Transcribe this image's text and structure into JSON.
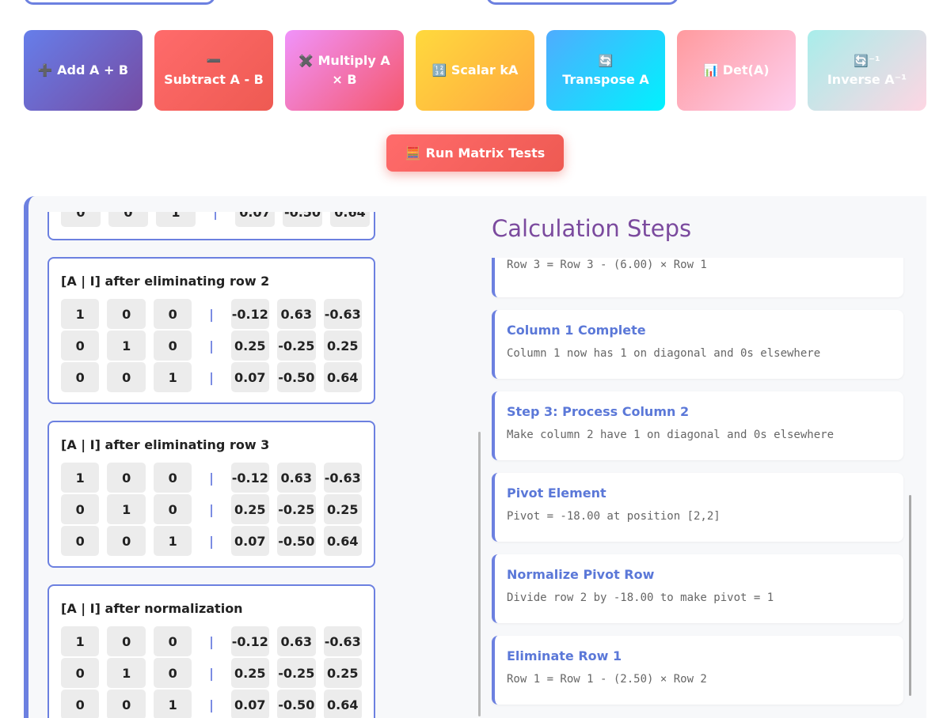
{
  "operations": [
    {
      "icon": "➕",
      "label": "Add A + B"
    },
    {
      "icon": "➖",
      "label": "Subtract A - B"
    },
    {
      "icon": "✖️",
      "label": "Multiply A × B"
    },
    {
      "icon": "🔢",
      "label": "Scalar kA"
    },
    {
      "icon": "🔄",
      "label": "Transpose A"
    },
    {
      "icon": "📊",
      "label": "Det(A)"
    },
    {
      "icon": "🔄⁻¹",
      "label": "Inverse A⁻¹"
    }
  ],
  "run_button": {
    "icon": "🧮",
    "label": "Run Matrix Tests"
  },
  "matrix_cards": {
    "partial": {
      "row": [
        "0",
        "0",
        "1",
        "0.07",
        "-0.50",
        "0.64"
      ]
    },
    "cards": [
      {
        "title": "[A | I] after eliminating row 2",
        "rows": [
          {
            "left": [
              "1",
              "0",
              "0"
            ],
            "sep": "|",
            "right": [
              "-0.12",
              "0.63",
              "-0.63"
            ]
          },
          {
            "left": [
              "0",
              "1",
              "0"
            ],
            "sep": "|",
            "right": [
              "0.25",
              "-0.25",
              "0.25"
            ]
          },
          {
            "left": [
              "0",
              "0",
              "1"
            ],
            "sep": "|",
            "right": [
              "0.07",
              "-0.50",
              "0.64"
            ]
          }
        ]
      },
      {
        "title": "[A | I] after eliminating row 3",
        "rows": [
          {
            "left": [
              "1",
              "0",
              "0"
            ],
            "sep": "|",
            "right": [
              "-0.12",
              "0.63",
              "-0.63"
            ]
          },
          {
            "left": [
              "0",
              "1",
              "0"
            ],
            "sep": "|",
            "right": [
              "0.25",
              "-0.25",
              "0.25"
            ]
          },
          {
            "left": [
              "0",
              "0",
              "1"
            ],
            "sep": "|",
            "right": [
              "0.07",
              "-0.50",
              "0.64"
            ]
          }
        ]
      },
      {
        "title": "[A | I] after normalization",
        "rows": [
          {
            "left": [
              "1",
              "0",
              "0"
            ],
            "sep": "|",
            "right": [
              "-0.12",
              "0.63",
              "-0.63"
            ]
          },
          {
            "left": [
              "0",
              "1",
              "0"
            ],
            "sep": "|",
            "right": [
              "0.25",
              "-0.25",
              "0.25"
            ]
          },
          {
            "left": [
              "0",
              "0",
              "1"
            ],
            "sep": "|",
            "right": [
              "0.07",
              "-0.50",
              "0.64"
            ]
          }
        ]
      }
    ]
  },
  "steps": {
    "title": "Calculation Steps",
    "items": [
      {
        "title": "",
        "desc": "Row 3 = Row 3 - (6.00) × Row 1"
      },
      {
        "title": "Column 1 Complete",
        "desc": "Column 1 now has 1 on diagonal and 0s elsewhere"
      },
      {
        "title": "Step 3: Process Column 2",
        "desc": "Make column 2 have 1 on diagonal and 0s elsewhere"
      },
      {
        "title": "Pivot Element",
        "desc": "Pivot = -18.00 at position [2,2]"
      },
      {
        "title": "Normalize Pivot Row",
        "desc": "Divide row 2 by -18.00 to make pivot = 1"
      },
      {
        "title": "Eliminate Row 1",
        "desc": "Row 1 = Row 1 - (2.50) × Row 2"
      }
    ]
  }
}
